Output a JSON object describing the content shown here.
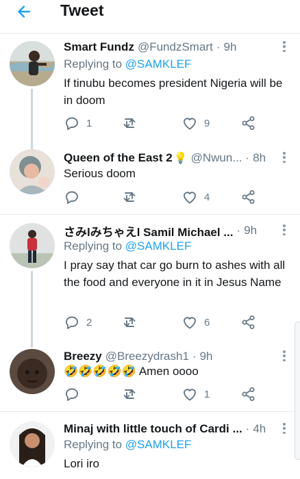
{
  "header": {
    "title": "Tweet",
    "back_icon": "arrow-left-icon"
  },
  "colors": {
    "accent": "#1da1f2",
    "secondary_text": "#657786",
    "icon": "#657786"
  },
  "tweets": [
    {
      "name": "Smart Fundz",
      "handle": "@FundzSmart",
      "time": "9h",
      "replying_prefix": "Replying to ",
      "replying_to": "@SAMKLEF",
      "text": "If tinubu becomes president Nigeria will be in doom",
      "reply_count": "1",
      "retweet_count": "",
      "like_count": "9"
    },
    {
      "name": "Queen of the East 2",
      "name_emoji": "💡",
      "handle": "@Nwun...",
      "time": "8h",
      "text": "Serious doom",
      "reply_count": "",
      "retweet_count": "",
      "like_count": "4"
    },
    {
      "name": "さみlみちゃえl Samil Michael ...",
      "time": "9h",
      "replying_prefix": "Replying to ",
      "replying_to": "@SAMKLEF",
      "text": "I pray say that car go burn to ashes with all the food and everyone in it in Jesus Name",
      "reply_count": "2",
      "retweet_count": "",
      "like_count": "6"
    },
    {
      "name": "Breezy",
      "handle": "@Breezydrash1",
      "time": "9h",
      "emojis": "🤣🤣🤣🤣🤣",
      "text": "Amen oooo",
      "reply_count": "",
      "retweet_count": "",
      "like_count": "1"
    },
    {
      "name": "Minaj with little touch of Cardi ...",
      "time": "4h",
      "replying_prefix": "Replying to ",
      "replying_to": "@SAMKLEF",
      "text": "Lori iro"
    }
  ]
}
